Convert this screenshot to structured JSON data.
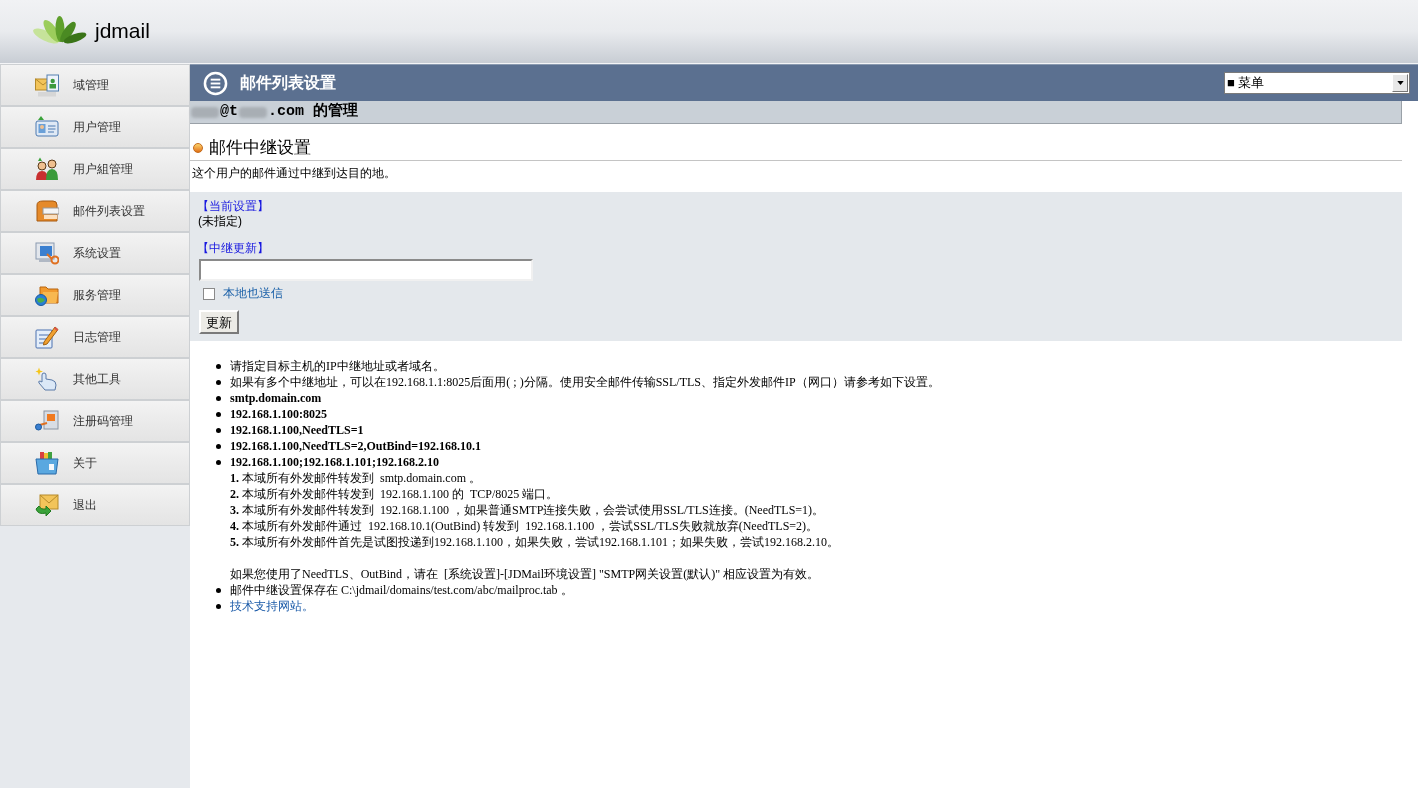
{
  "header": {
    "logo_text": "jdmail"
  },
  "sidebar": {
    "items": [
      {
        "label": "域管理"
      },
      {
        "label": "用户管理"
      },
      {
        "label": "用户組管理"
      },
      {
        "label": "邮件列表设置"
      },
      {
        "label": "系统设置"
      },
      {
        "label": "服务管理"
      },
      {
        "label": "日志管理"
      },
      {
        "label": "其他工具"
      },
      {
        "label": "注册码管理"
      },
      {
        "label": "关于"
      },
      {
        "label": "退出"
      }
    ]
  },
  "title_bar": {
    "title": "邮件列表设置",
    "menu_select": {
      "value": "■ 菜单"
    }
  },
  "admin_row": {
    "parts": [
      {
        "kind": "redacted"
      },
      {
        "kind": "text",
        "text": "@t"
      },
      {
        "kind": "redacted"
      },
      {
        "kind": "text",
        "text": ".com 的管理"
      }
    ]
  },
  "section": {
    "title": "邮件中继设置",
    "description": "这个用户的邮件通过中继到达目的地。"
  },
  "panel": {
    "current_label": "【当前设置】",
    "current_value": "(未指定)",
    "update_label": "【中继更新】",
    "local_delivery": {
      "label": "本地也送信",
      "checked": false
    },
    "submit_button": "更新"
  },
  "notes": [
    {
      "kind": "bullet",
      "text": "请指定目标主机的IP中继地址或者域名。"
    },
    {
      "kind": "bullet",
      "text": "如果有多个中继地址，可以在192.168.1.1:8025后面用( ; )分隔。使用安全邮件传输SSL/TLS、指定外发邮件IP（网口）请参考如下设置。"
    },
    {
      "kind": "bullet_bold",
      "text": "smtp.domain.com"
    },
    {
      "kind": "bullet_bold",
      "text": "192.168.1.100:8025"
    },
    {
      "kind": "bullet_bold",
      "text": "192.168.1.100,NeedTLS=1"
    },
    {
      "kind": "bullet_bold",
      "text": "192.168.1.100,NeedTLS=2,OutBind=192.168.10.1"
    },
    {
      "kind": "bullet_bold",
      "text": "192.168.1.100;192.168.1.101;192.168.2.10",
      "lines": [
        "**1.** 本域所有外发邮件转发到  smtp.domain.com 。",
        "**2.** 本域所有外发邮件转发到  192.168.1.100 的  TCP/8025 端口。",
        "**3.** 本域所有外发邮件转发到  192.168.1.100 ，如果普通SMTP连接失败，会尝试使用SSL/TLS连接。(NeedTLS=1)。",
        "**4.** 本域所有外发邮件通过  192.168.10.1(OutBind) 转发到  192.168.1.100 ，尝试SSL/TLS失败就放弃(NeedTLS=2)。",
        "**5.** 本域所有外发邮件首先是试图投递到192.168.1.100，如果失败，尝试192.168.1.101；如果失败，尝试192.168.2.10。"
      ],
      "note": "如果您使用了NeedTLS、OutBind，请在  [系统设置]-[JDMail环境设置] \"SMTP网关设置(默认)\" 相应设置为有效。"
    },
    {
      "kind": "bullet",
      "text": "邮件中继设置保存在  C:\\jdmail/domains/test.com/abc/mailproc.tab 。"
    },
    {
      "kind": "link",
      "text": "技术支持网站。"
    }
  ]
}
